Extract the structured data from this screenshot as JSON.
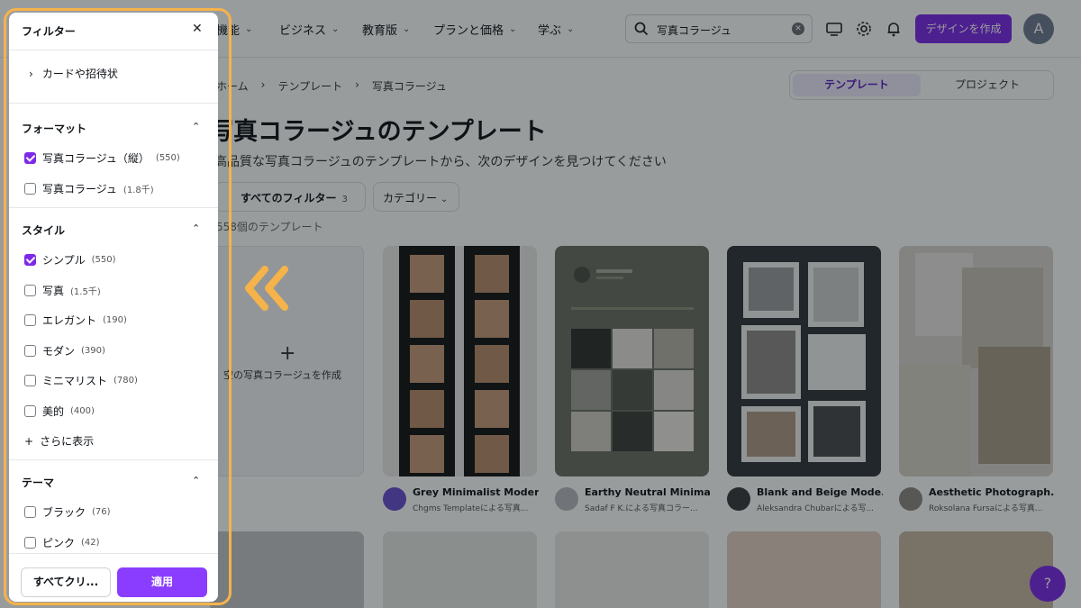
{
  "colors": {
    "brand_purple": "#7d2ae8",
    "highlight": "#f5b34a"
  },
  "topbar": {
    "nav": [
      {
        "label": "機能"
      },
      {
        "label": "ビジネス"
      },
      {
        "label": "教育版"
      },
      {
        "label": "プランと価格"
      },
      {
        "label": "学ぶ"
      }
    ],
    "search_value": "写真コラージュ",
    "create_label": "デザインを作成",
    "avatar_initial": "A",
    "icons": [
      "search-icon",
      "clear-icon",
      "monitor-icon",
      "gear-icon",
      "bell-icon"
    ]
  },
  "breadcrumb": [
    "ホーム",
    "テンプレート",
    "写真コラージュ"
  ],
  "segment": {
    "active": "テンプレート",
    "inactive": "プロジェクト"
  },
  "main": {
    "title": "写真コラージュのテンプレート",
    "subtitle": "高品質な写真コラージュのテンプレートから、次のデザインを見つけてください",
    "all_filters_label": "すべてのフィルター",
    "all_filters_count": "3",
    "category_label": "カテゴリー",
    "result_count": "558個のテンプレート",
    "blank_card_label": "空の写真コラージュを作成"
  },
  "cards": [
    {
      "title": "Grey Minimalist Moder...",
      "author": "Chgms Templateによる写真..."
    },
    {
      "title": "Earthy Neutral Minima...",
      "author": "Sadaf F K.による写真コラー..."
    },
    {
      "title": "Blank and Beige Mode...",
      "author": "Aleksandra Chubarによる写..."
    },
    {
      "title": "Aesthetic Photograph...",
      "author": "Roksolana Fursaによる写真..."
    }
  ],
  "help_label": "?",
  "filter_panel": {
    "title": "フィルター",
    "category_link": "カードや招待状",
    "sections": {
      "format": {
        "title": "フォーマット",
        "options": [
          {
            "label": "写真コラージュ（縦）",
            "count": "(550)",
            "checked": true
          },
          {
            "label": "写真コラージュ",
            "count": "(1.8千)",
            "checked": false
          }
        ]
      },
      "style": {
        "title": "スタイル",
        "options": [
          {
            "label": "シンプル",
            "count": "(550)",
            "checked": true
          },
          {
            "label": "写真",
            "count": "(1.5千)",
            "checked": false
          },
          {
            "label": "エレガント",
            "count": "(190)",
            "checked": false
          },
          {
            "label": "モダン",
            "count": "(390)",
            "checked": false
          },
          {
            "label": "ミニマリスト",
            "count": "(780)",
            "checked": false
          },
          {
            "label": "美的",
            "count": "(400)",
            "checked": false
          }
        ],
        "show_more": "さらに表示"
      },
      "theme": {
        "title": "テーマ",
        "options": [
          {
            "label": "ブラック",
            "count": "(76)",
            "checked": false
          },
          {
            "label": "ピンク",
            "count": "(42)",
            "checked": false
          }
        ]
      }
    },
    "clear_label": "すべてクリ...",
    "apply_label": "適用"
  }
}
